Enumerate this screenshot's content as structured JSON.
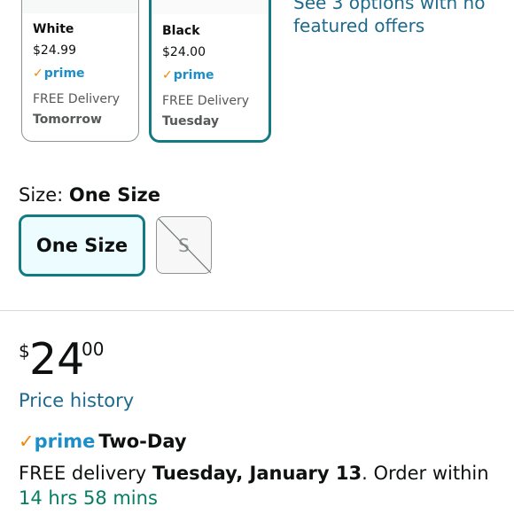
{
  "swatches": [
    {
      "color": "White",
      "price": "$24.99",
      "prime": "prime",
      "delivery": "FREE Delivery",
      "day": "Tomorrow"
    },
    {
      "color": "Black",
      "price": "$24.00",
      "prime": "prime",
      "delivery": "FREE Delivery",
      "day": "Tuesday"
    }
  ],
  "see_options": "See 3 options with no featured offers",
  "size": {
    "label": "Size: ",
    "value": "One Size",
    "options": [
      "One Size",
      "S"
    ]
  },
  "price": {
    "symbol": "$",
    "whole": "24",
    "fraction": "00"
  },
  "price_history": "Price history",
  "prime_delivery": {
    "prime": "prime",
    "type": "Two-Day"
  },
  "delivery": {
    "prefix": "FREE delivery ",
    "date": "Tuesday, January 13",
    "mid": ". Order within ",
    "countdown": "14 hrs 58 mins"
  },
  "colors": {
    "accent": "#137a82",
    "link": "#1e6a8c",
    "prime_blue": "#1d8ec7",
    "prime_check": "#f08804",
    "countdown": "#067d62"
  }
}
